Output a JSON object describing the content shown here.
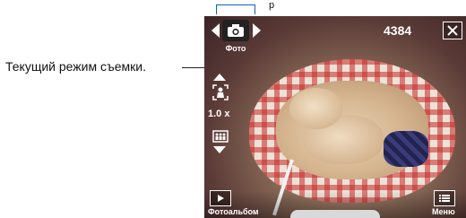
{
  "callout": {
    "text": "Текущий режим съемки.",
    "top_text": "р"
  },
  "camera": {
    "mode_label": "Фото",
    "counter": "4384",
    "zoom_level": "1.0 x",
    "album_label": "Фотоальбом",
    "menu_label": "Меню"
  },
  "icons": {
    "mode": "camera-icon",
    "prev_mode": "chevron-left-icon",
    "next_mode": "chevron-right-icon",
    "close": "close-icon",
    "zoom_in": "zoom-in-person-icon",
    "zoom_out": "zoom-out-wide-icon",
    "album": "play-icon",
    "menu": "menu-list-icon"
  },
  "colors": {
    "bracket": "#0c63b7",
    "overlay_text": "#ffffff"
  }
}
